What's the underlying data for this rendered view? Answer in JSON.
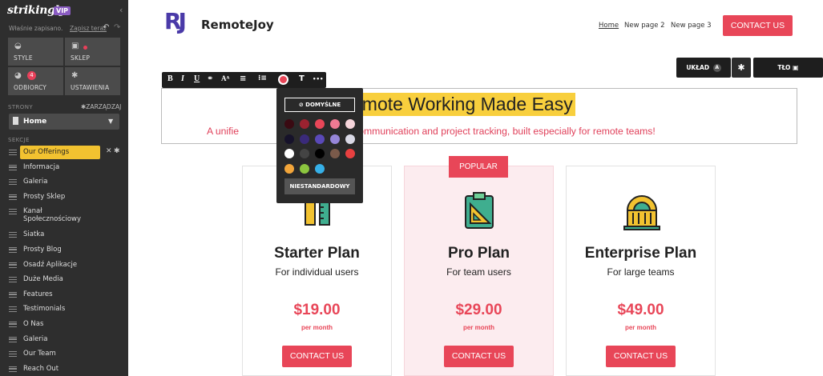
{
  "sidebar": {
    "logo": "strikingly",
    "vip": "VIP",
    "saved_text": "Właśnie zapisano.",
    "save_now": "Zapisz teraz",
    "tiles": [
      {
        "label": "STYLE",
        "icon": "palette-icon"
      },
      {
        "label": "SKLEP",
        "icon": "shop-bag-icon"
      },
      {
        "label": "ODBIORCY",
        "icon": "people-icon",
        "badge": "4"
      },
      {
        "label": "USTAWIENIA",
        "icon": "gear-icon"
      }
    ],
    "pages_label": "STRONY",
    "manage_label": "ZARZĄDZAJ",
    "current_page": "Home",
    "sections_label": "SEKCJE",
    "sections": [
      "Our Offerings",
      "Informacja",
      "Galeria",
      "Prosty Sklep",
      "Kanał Społecznościowy",
      "Siatka",
      "Prosty Blog",
      "Osadź Aplikacje",
      "Duże Media",
      "Features",
      "Testimonials",
      "O Nas",
      "Galeria",
      "Our Team",
      "Reach Out"
    ]
  },
  "site": {
    "brand_mark": "RJ",
    "brand_name": "RemoteJoy",
    "nav": [
      "Home",
      "New page 2",
      "New page 3"
    ],
    "header_cta": "CONTACT US",
    "editor_buttons": {
      "layout": "UKŁAD",
      "layout_badge": "A",
      "background": "TŁO"
    },
    "hero_title": "emote Working Made Easy",
    "hero_subtitle_left": "A unifie",
    "hero_subtitle_right": "n communication and project tracking, built especially for remote teams!",
    "popular_badge": "POPULAR",
    "plans": [
      {
        "name": "Starter Plan",
        "desc": "For individual users",
        "price": "$19.00",
        "period": "per month",
        "cta": "CONTACT US"
      },
      {
        "name": "Pro Plan",
        "desc": "For team users",
        "price": "$29.00",
        "period": "per month",
        "cta": "CONTACT US"
      },
      {
        "name": "Enterprise Plan",
        "desc": "For large teams",
        "price": "$49.00",
        "period": "per month",
        "cta": "CONTACT US"
      }
    ]
  },
  "text_toolbar": {
    "buttons": [
      "B",
      "I",
      "U"
    ],
    "t_button": "T",
    "more": "•••"
  },
  "color_popover": {
    "default_label": "DOMYŚLNE",
    "custom_label": "NIESTANDARDOWY",
    "swatches": [
      "#3a0a12",
      "#9b2230",
      "#e84658",
      "#ef7a93",
      "#f6d5db",
      "#16122a",
      "#3a2a7a",
      "#5a49b8",
      "#9686d9",
      "#d9d9e6",
      "#ffffff",
      "#444444",
      "#000000",
      "#7a5a4a",
      "#e84040",
      "#f2a53a",
      "#8cc63f",
      "#36b0e8"
    ]
  },
  "colors": {
    "accent": "#e84658",
    "highlight": "#f8cf3d",
    "sidebar": "#2e2e2e",
    "brand": "#4a3aa8"
  }
}
